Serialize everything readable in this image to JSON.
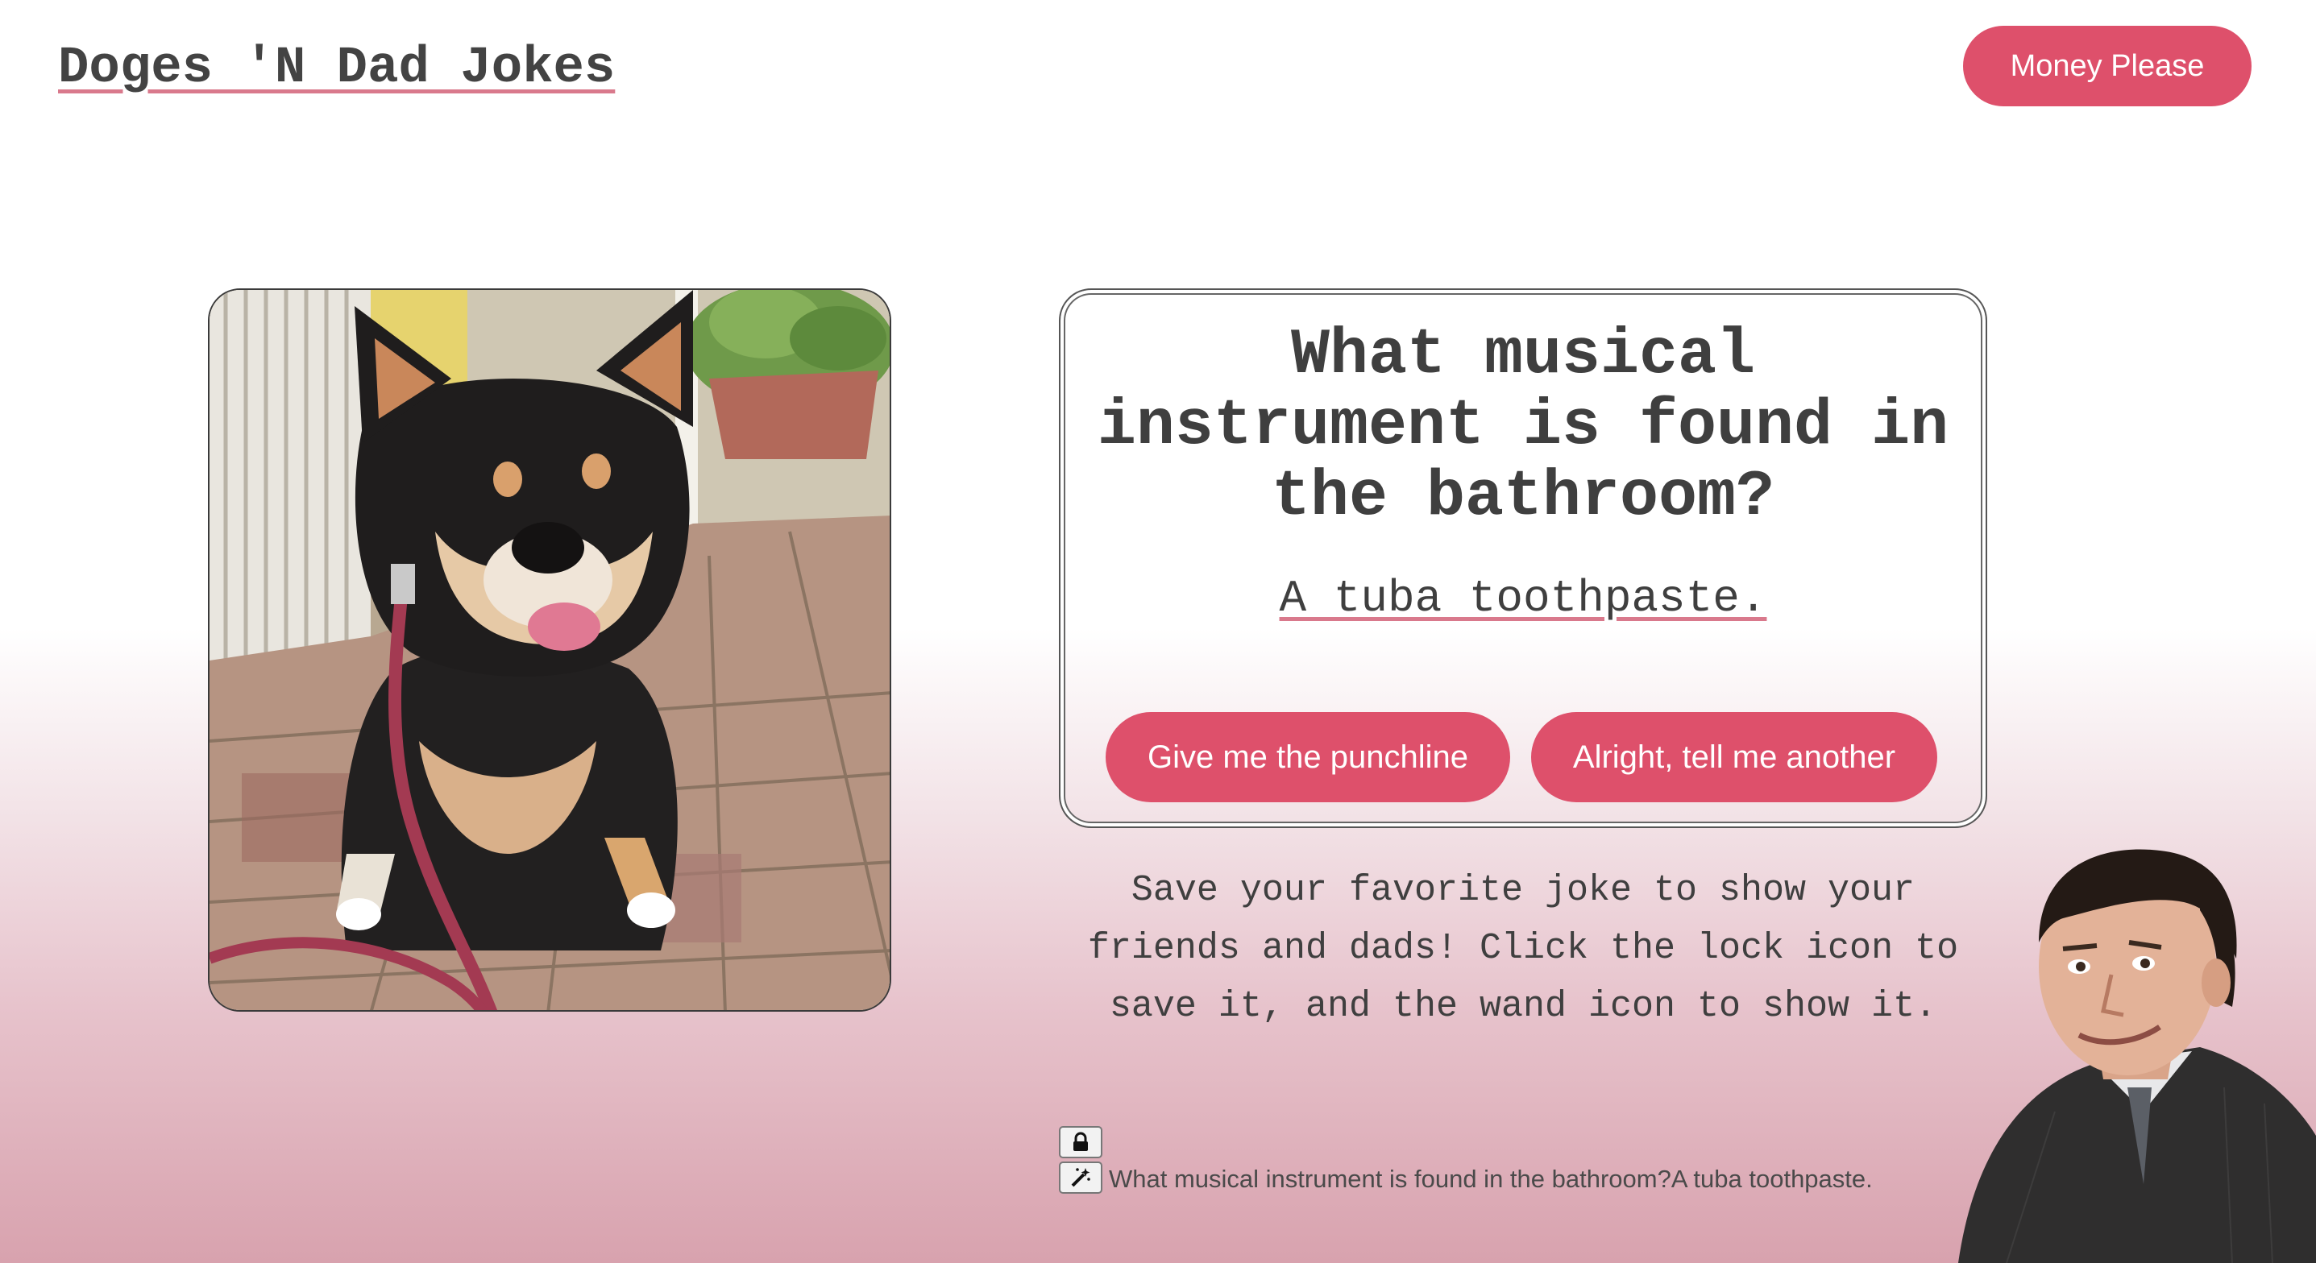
{
  "header": {
    "title": "Doges 'N Dad Jokes",
    "money_button": "Money Please"
  },
  "photo": {
    "subject": "shiba-inu-dog-photo"
  },
  "joke": {
    "question": "What musical instrument is found in the bathroom?",
    "punchline": "A tuba toothpaste.",
    "punchline_button": "Give me the punchline",
    "another_button": "Alright, tell me another"
  },
  "instructions": "Save your favorite joke to show your friends and dads! Click the lock icon to save it, and the wand icon to show it.",
  "saved": {
    "lock_icon": "lock-icon",
    "wand_icon": "magic-wand-icon",
    "text": "What musical instrument is found in the bathroom?A tuba toothpaste."
  },
  "figure": {
    "subject": "man-in-suit-smirking-figure"
  },
  "colors": {
    "accent": "#de506b",
    "underline": "#d9798c",
    "text": "#3f3f3f",
    "gradient_bottom": "#d8a2ae"
  }
}
